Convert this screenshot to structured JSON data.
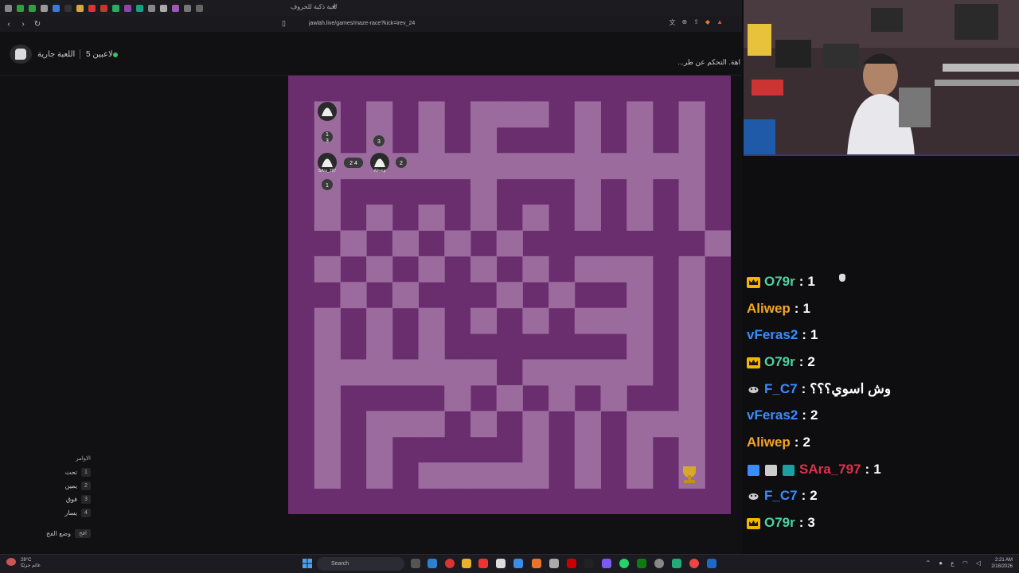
{
  "browser": {
    "tab_title": "لعبة ذكية للحروف",
    "url": "jawlah.live/games/maze-race?kick=irev_24"
  },
  "header": {
    "status": "اللعبة جارية",
    "players": "5 لاعبين"
  },
  "banner": "اهة. التحكم عن طر...",
  "maze": {
    "markers": [
      "1",
      "3",
      "3",
      "2 4",
      "2",
      "1"
    ],
    "player_names": [
      "SAra_797",
      "Aliwep"
    ]
  },
  "controls": {
    "title": "الاوامر",
    "items": [
      {
        "key": "1",
        "label": "تحت"
      },
      {
        "key": "2",
        "label": "يمين"
      },
      {
        "key": "3",
        "label": "فوق"
      },
      {
        "key": "4",
        "label": "يسار"
      }
    ],
    "cheat_label": "وضع الفخ",
    "cheat_key": "افخ"
  },
  "chat": [
    {
      "user": "O79r",
      "color": "#4fd1a0",
      "badge": "crown",
      "msg": "1"
    },
    {
      "user": "Aliwep",
      "color": "#f5a623",
      "badge": "",
      "msg": "1"
    },
    {
      "user": "vFeras2",
      "color": "#3b8cff",
      "badge": "",
      "msg": "1"
    },
    {
      "user": "O79r",
      "color": "#4fd1a0",
      "badge": "crown",
      "msg": "2"
    },
    {
      "user": "F_C7",
      "color": "#3b8cff",
      "badge": "alien",
      "msg": "وش اسوي؟؟؟"
    },
    {
      "user": "vFeras2",
      "color": "#3b8cff",
      "badge": "",
      "msg": "2"
    },
    {
      "user": "Aliwep",
      "color": "#f5a623",
      "badge": "",
      "msg": "2"
    },
    {
      "user": "SAra_797",
      "color": "#e0314b",
      "badge": "multi",
      "msg": "1"
    },
    {
      "user": "F_C7",
      "color": "#3b8cff",
      "badge": "alien",
      "msg": "2"
    },
    {
      "user": "O79r",
      "color": "#4fd1a0",
      "badge": "crown",
      "msg": "3"
    }
  ],
  "taskbar": {
    "temp": "28°C",
    "weather": "غائم جزئيًا",
    "search": "Search",
    "time": "2:21 AM",
    "date": "2/18/2026"
  }
}
